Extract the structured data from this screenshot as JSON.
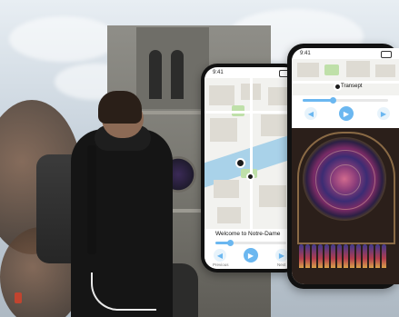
{
  "photo": {
    "description_icons": [
      "backpack-icon",
      "headphones-cable-icon"
    ]
  },
  "phone_left": {
    "status_time": "9:41",
    "welcome_text": "Welcome to Notre-Dame",
    "progress_fraction": 0.2,
    "controls": {
      "back_label": "Previous",
      "next_label": "Next"
    }
  },
  "phone_right": {
    "status_time": "9:41",
    "track_title": "Transept",
    "progress_fraction": 0.35
  }
}
